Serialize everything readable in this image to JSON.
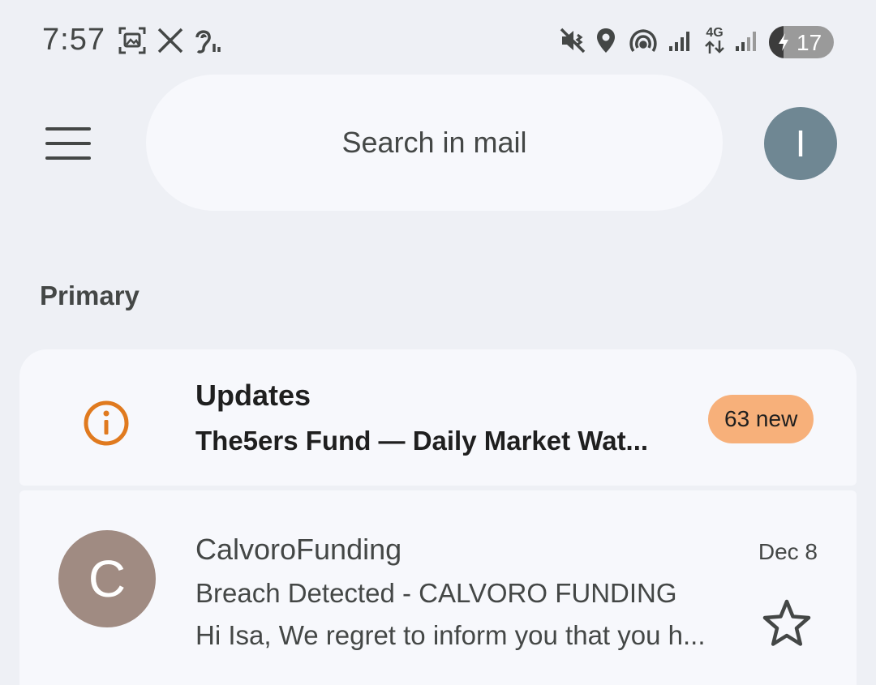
{
  "status_bar": {
    "time": "7:57",
    "icons": [
      "screenshot-icon",
      "x-app-icon",
      "hearing-icon",
      "vibrate-mute-icon",
      "location-icon",
      "hotspot-icon",
      "signal-icon",
      "4g-data-icon",
      "signal-2-icon"
    ],
    "network_label": "4G",
    "battery_level": "17"
  },
  "header": {
    "search_placeholder": "Search in mail",
    "avatar_initial": "I"
  },
  "section": {
    "label": "Primary"
  },
  "updates": {
    "title": "Updates",
    "snippet": "The5ers Fund — Daily Market Wat...",
    "badge": "63 new",
    "icon": "info-icon"
  },
  "emails": [
    {
      "avatar_initial": "C",
      "sender": "CalvoroFunding",
      "date": "Dec 8",
      "subject": "Breach Detected - CALVORO FUNDING",
      "preview": "Hi Isa, We regret to inform you that you h...",
      "starred": false
    }
  ],
  "colors": {
    "background": "#eef0f5",
    "card": "#f7f8fc",
    "badge": "#f7b07a",
    "info_icon": "#e07a1f",
    "user_avatar": "#6f8793",
    "sender_avatar": "#a08b82"
  }
}
